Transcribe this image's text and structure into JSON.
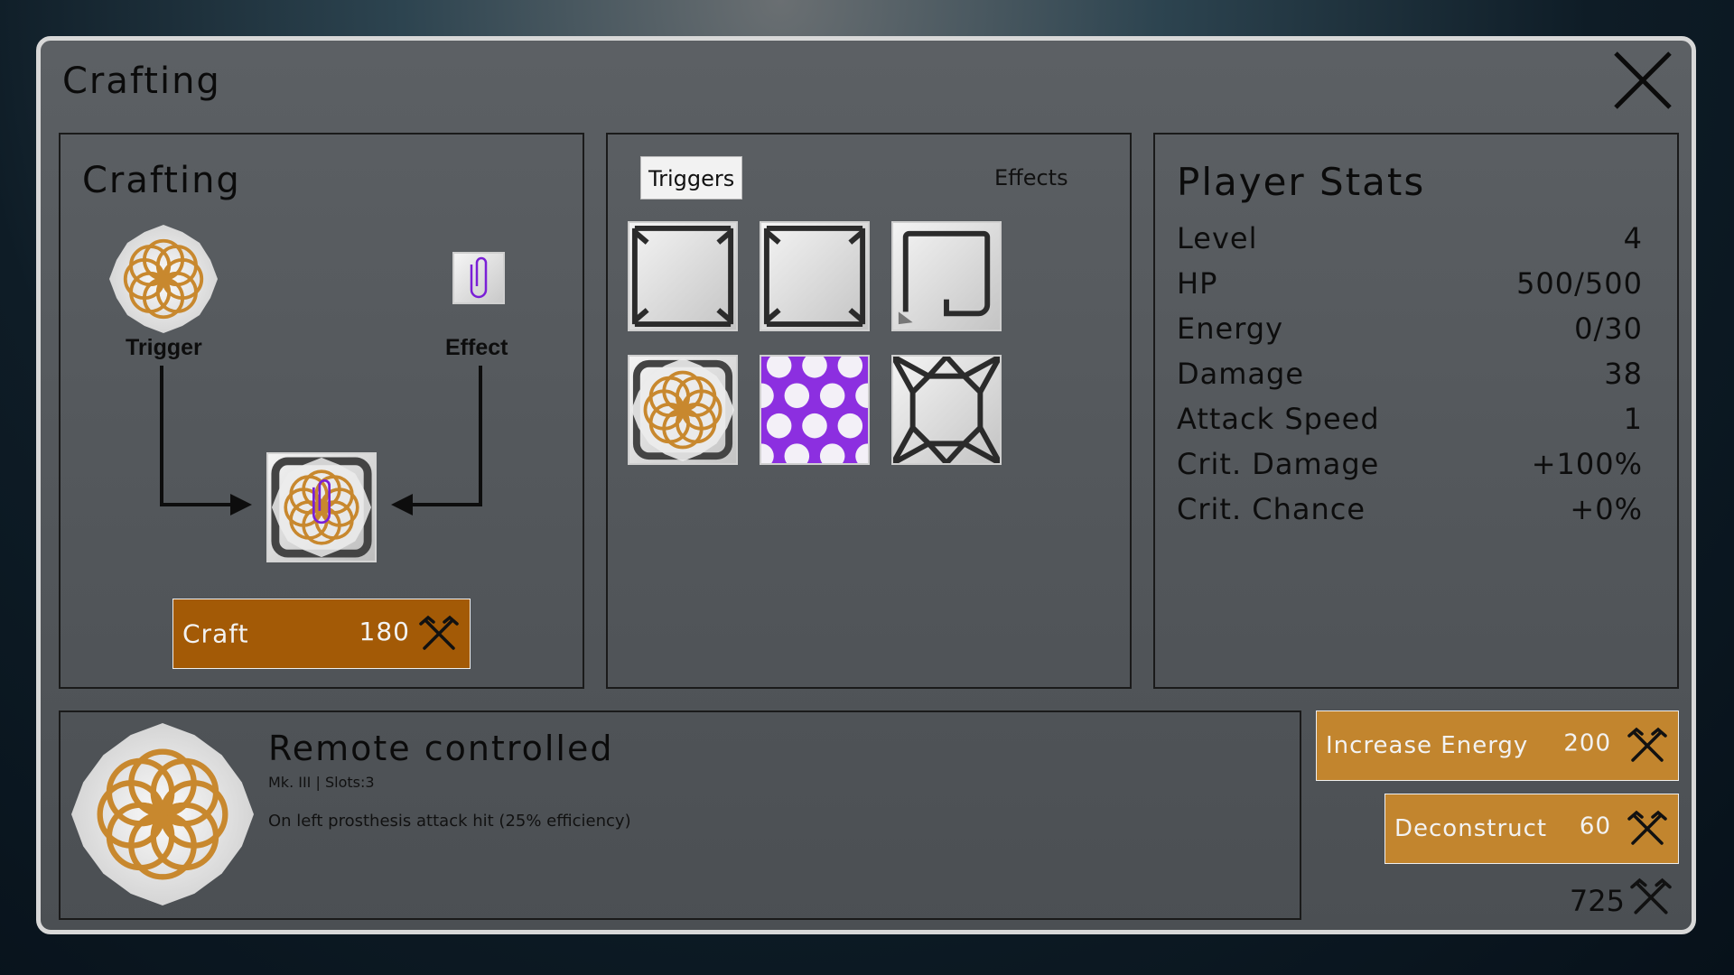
{
  "window": {
    "title": "Crafting"
  },
  "crafting": {
    "heading": "Crafting",
    "trigger_label": "Trigger",
    "effect_label": "Effect",
    "craft_button": {
      "label": "Craft",
      "cost": "180"
    }
  },
  "tabs": [
    {
      "label": "Triggers",
      "active": true
    },
    {
      "label": "Effects",
      "active": false
    }
  ],
  "inventory": [
    {
      "icon": "frame-corners-icon"
    },
    {
      "icon": "frame-corners-icon"
    },
    {
      "icon": "hook-frame-icon"
    },
    {
      "icon": "gold-lattice-frame-icon"
    },
    {
      "icon": "purple-hexagon-pattern-icon"
    },
    {
      "icon": "octagon-lattice-icon"
    }
  ],
  "stats": {
    "heading": "Player Stats",
    "rows": [
      {
        "label": "Level",
        "value": "4"
      },
      {
        "label": "HP",
        "value": "500/500"
      },
      {
        "label": "Energy",
        "value": "0/30"
      },
      {
        "label": "Damage",
        "value": "38"
      },
      {
        "label": "Attack Speed",
        "value": "1"
      },
      {
        "label": "Crit. Damage",
        "value": "+100%"
      },
      {
        "label": "Crit. Chance",
        "value": "+0%"
      }
    ]
  },
  "item": {
    "title": "Remote controlled",
    "subtitle": "Mk. III | Slots:3",
    "description": "On left prosthesis attack hit (25% efficiency)"
  },
  "actions": {
    "increase_energy": {
      "label": "Increase Energy",
      "cost": "200"
    },
    "deconstruct": {
      "label": "Deconstruct",
      "cost": "60"
    }
  },
  "currency": {
    "amount": "725"
  },
  "colors": {
    "craft_button": "#a35a06",
    "action_button": "#c2852e",
    "gold": "#c8882e",
    "purple": "#7a1fd6"
  }
}
